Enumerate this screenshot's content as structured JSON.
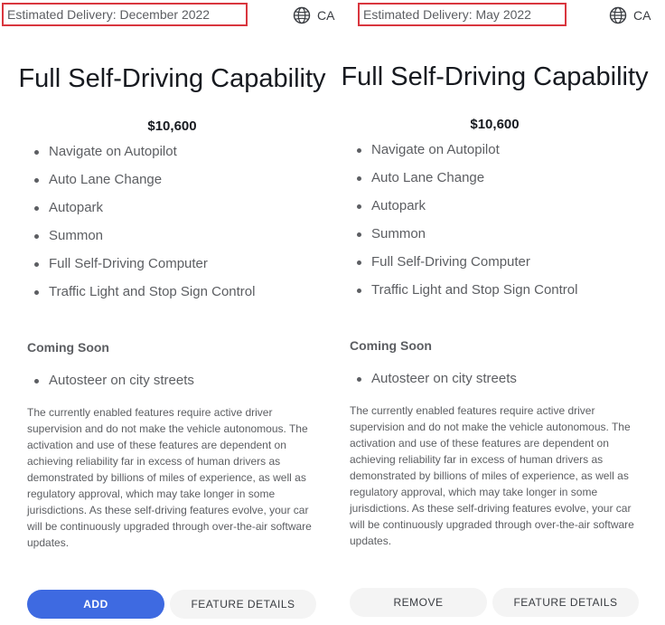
{
  "panels": [
    {
      "delivery": "Estimated Delivery: December 2022",
      "region": "CA",
      "title": "Full Self-Driving Capability",
      "price": "$10,600",
      "features": [
        "Navigate on Autopilot",
        "Auto Lane Change",
        "Autopark",
        "Summon",
        "Full Self-Driving Computer",
        "Traffic Light and Stop Sign Control"
      ],
      "coming_soon_heading": "Coming Soon",
      "coming_soon": [
        "Autosteer on city streets"
      ],
      "disclaimer": "The currently enabled features require active driver supervision and do not make the vehicle autonomous. The activation and use of these features are dependent on achieving reliability far in excess of human drivers as demonstrated by billions of miles of experience, as well as regulatory approval, which may take longer in some jurisdictions. As these self-driving features evolve, your car will be continuously upgraded through over-the-air software updates.",
      "primary_button": "ADD",
      "details_button": "FEATURE DETAILS"
    },
    {
      "delivery": "Estimated Delivery: May 2022",
      "region": "CA",
      "title": "Full Self-Driving Capability",
      "price": "$10,600",
      "features": [
        "Navigate on Autopilot",
        "Auto Lane Change",
        "Autopark",
        "Summon",
        "Full Self-Driving Computer",
        "Traffic Light and Stop Sign Control"
      ],
      "coming_soon_heading": "Coming Soon",
      "coming_soon": [
        "Autosteer on city streets"
      ],
      "disclaimer": "The currently enabled features require active driver supervision and do not make the vehicle autonomous. The activation and use of these features are dependent on achieving reliability far in excess of human drivers as demonstrated by billions of miles of experience, as well as regulatory approval, which may take longer in some jurisdictions. As these self-driving features evolve, your car will be continuously upgraded through over-the-air software updates.",
      "primary_button": "REMOVE",
      "details_button": "FEATURE DETAILS"
    }
  ],
  "icons": {
    "region": "globe-icon"
  },
  "colors": {
    "primary": "#3e6ae1",
    "secondary": "#f4f4f4",
    "highlight": "#d9363e"
  }
}
